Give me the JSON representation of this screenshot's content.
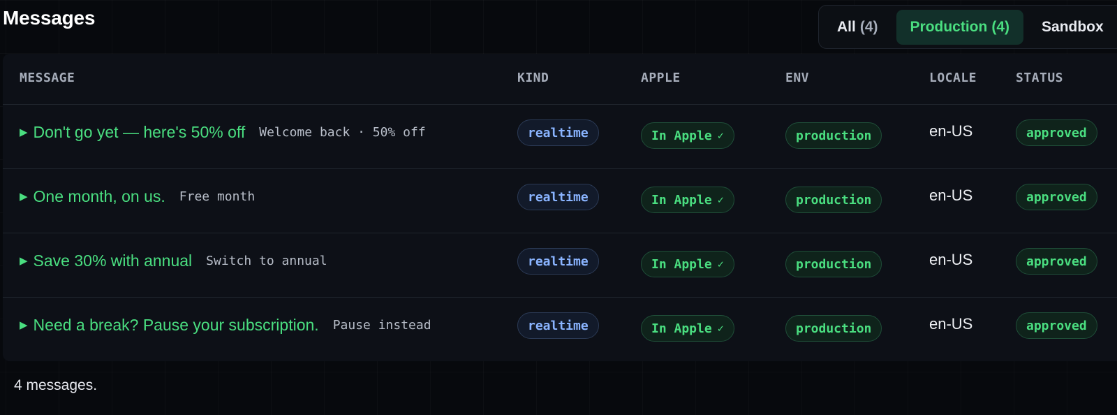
{
  "page": {
    "title": "Messages"
  },
  "filters": [
    {
      "label": "All",
      "count": "(4)",
      "active": false
    },
    {
      "label": "Production",
      "count": "(4)",
      "active": true
    },
    {
      "label": "Sandbox",
      "count": "",
      "active": false
    }
  ],
  "table": {
    "columns": [
      "MESSAGE",
      "KIND",
      "APPLE",
      "ENV",
      "LOCALE",
      "STATUS"
    ],
    "rows": [
      {
        "title": "Don't go yet — here's 50% off",
        "subtitle": "Welcome back · 50% off",
        "kind": "realtime",
        "apple": "In Apple",
        "apple_check": "✓",
        "env": "production",
        "locale": "en-US",
        "status": "approved"
      },
      {
        "title": "One month, on us.",
        "subtitle": "Free month",
        "kind": "realtime",
        "apple": "In Apple",
        "apple_check": "✓",
        "env": "production",
        "locale": "en-US",
        "status": "approved"
      },
      {
        "title": "Save 30% with annual",
        "subtitle": "Switch to annual",
        "kind": "realtime",
        "apple": "In Apple",
        "apple_check": "✓",
        "env": "production",
        "locale": "en-US",
        "status": "approved"
      },
      {
        "title": "Need a break? Pause your subscription.",
        "subtitle": "Pause instead",
        "kind": "realtime",
        "apple": "In Apple",
        "apple_check": "✓",
        "env": "production",
        "locale": "en-US",
        "status": "approved"
      }
    ]
  },
  "footer": {
    "summary": "4 messages."
  },
  "icons": {
    "row_expand": "caret-right-icon",
    "apple_status": "check-icon"
  },
  "colors": {
    "accent_green": "#4ade80",
    "kind_blue": "#8ab4ff",
    "background": "#07090d",
    "card": "#0d1017"
  }
}
